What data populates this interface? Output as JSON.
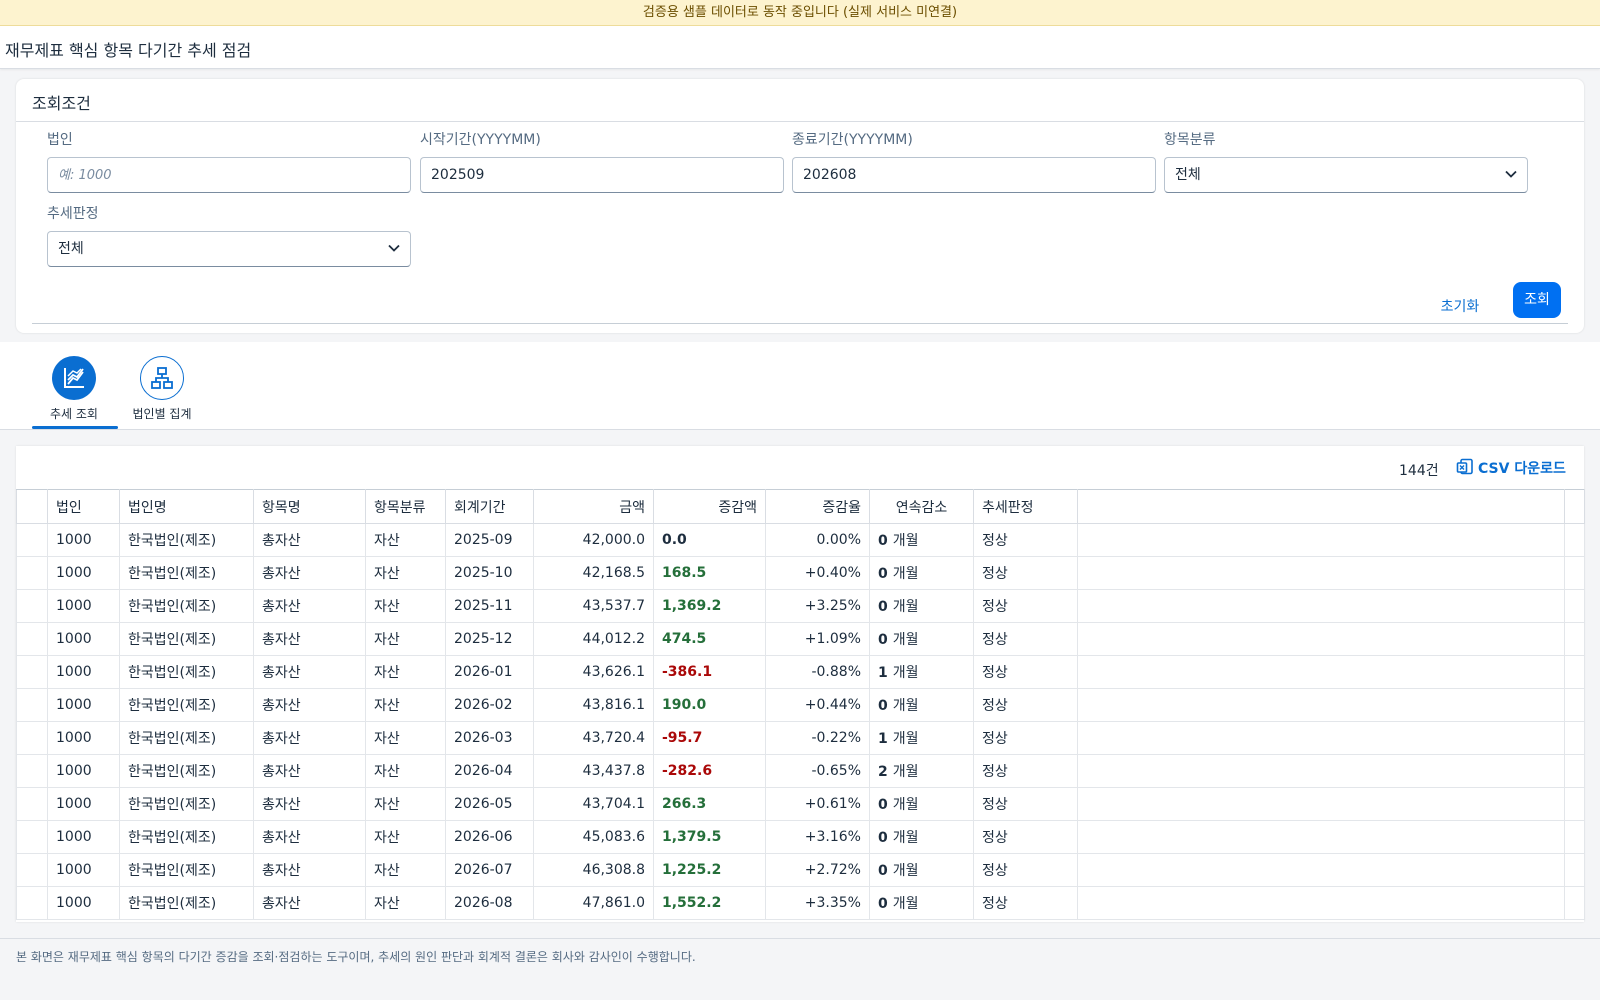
{
  "banner": "검증용 샘플 데이터로 동작 중입니다 (실제 서비스 미연결)",
  "page_title": "재무제표 핵심 항목 다기간 추세 점검",
  "filter": {
    "title": "조회조건",
    "corp": {
      "label": "법인",
      "value": "",
      "placeholder": "예: 1000"
    },
    "start": {
      "label": "시작기간(YYYYMM)",
      "value": "202509"
    },
    "end": {
      "label": "종료기간(YYYYMM)",
      "value": "202608"
    },
    "category": {
      "label": "항목분류",
      "value": "전체"
    },
    "trend": {
      "label": "추세판정",
      "value": "전체"
    },
    "reset_label": "초기화",
    "search_label": "조회"
  },
  "tabs": [
    {
      "label": "추세 조회",
      "icon": "line-chart-icon",
      "active": true
    },
    {
      "label": "법인별 집계",
      "icon": "org-chart-icon",
      "active": false
    }
  ],
  "table": {
    "count": "144건",
    "csv_label": "CSV 다운로드",
    "columns": [
      "법인",
      "법인명",
      "항목명",
      "항목분류",
      "회계기간",
      "금액",
      "증감액",
      "증감율",
      "연속감소",
      "추세판정"
    ],
    "unit_month": "개월",
    "rows": [
      [
        "1000",
        "한국법인(제조)",
        "총자산",
        "자산",
        "2025-09",
        "42,000.0",
        "0.0",
        "0.00%",
        "0",
        "정상"
      ],
      [
        "1000",
        "한국법인(제조)",
        "총자산",
        "자산",
        "2025-10",
        "42,168.5",
        "168.5",
        "+0.40%",
        "0",
        "정상"
      ],
      [
        "1000",
        "한국법인(제조)",
        "총자산",
        "자산",
        "2025-11",
        "43,537.7",
        "1,369.2",
        "+3.25%",
        "0",
        "정상"
      ],
      [
        "1000",
        "한국법인(제조)",
        "총자산",
        "자산",
        "2025-12",
        "44,012.2",
        "474.5",
        "+1.09%",
        "0",
        "정상"
      ],
      [
        "1000",
        "한국법인(제조)",
        "총자산",
        "자산",
        "2026-01",
        "43,626.1",
        "-386.1",
        "-0.88%",
        "1",
        "정상"
      ],
      [
        "1000",
        "한국법인(제조)",
        "총자산",
        "자산",
        "2026-02",
        "43,816.1",
        "190.0",
        "+0.44%",
        "0",
        "정상"
      ],
      [
        "1000",
        "한국법인(제조)",
        "총자산",
        "자산",
        "2026-03",
        "43,720.4",
        "-95.7",
        "-0.22%",
        "1",
        "정상"
      ],
      [
        "1000",
        "한국법인(제조)",
        "총자산",
        "자산",
        "2026-04",
        "43,437.8",
        "-282.6",
        "-0.65%",
        "2",
        "정상"
      ],
      [
        "1000",
        "한국법인(제조)",
        "총자산",
        "자산",
        "2026-05",
        "43,704.1",
        "266.3",
        "+0.61%",
        "0",
        "정상"
      ],
      [
        "1000",
        "한국법인(제조)",
        "총자산",
        "자산",
        "2026-06",
        "45,083.6",
        "1,379.5",
        "+3.16%",
        "0",
        "정상"
      ],
      [
        "1000",
        "한국법인(제조)",
        "총자산",
        "자산",
        "2026-07",
        "46,308.8",
        "1,225.2",
        "+2.72%",
        "0",
        "정상"
      ],
      [
        "1000",
        "한국법인(제조)",
        "총자산",
        "자산",
        "2026-08",
        "47,861.0",
        "1,552.2",
        "+3.35%",
        "0",
        "정상"
      ]
    ]
  },
  "footer_note": "본 화면은 재무제표 핵심 항목의 다기간 증감을 조회·점검하는 도구이며, 추세의 원인 판단과 회계적 결론은 회사와 감사인이 수행합니다.",
  "colors": {
    "accent": "#0a6ed1",
    "positive": "#256f3a",
    "negative": "#aa0808",
    "banner_bg": "#fdf3cf"
  }
}
